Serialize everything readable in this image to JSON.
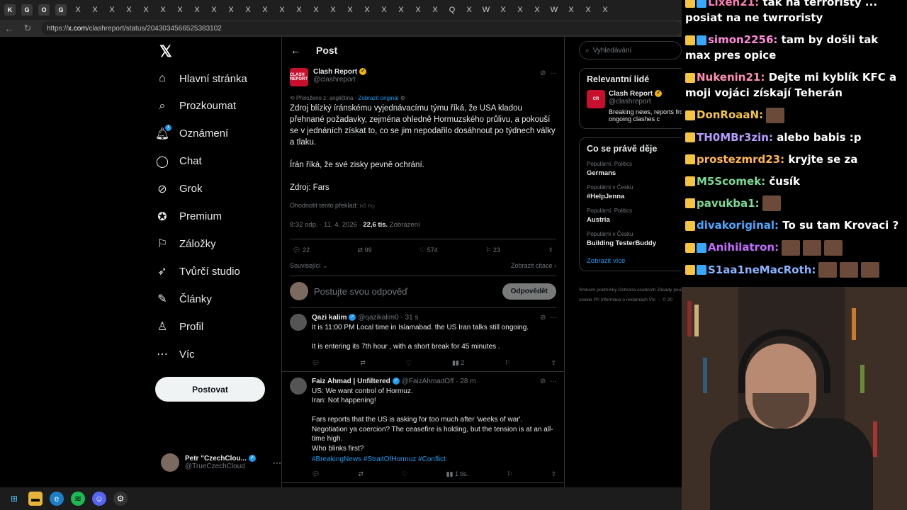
{
  "browser": {
    "url_prefix": "https://",
    "url_host": "x.com",
    "url_path": "/clashreport/status/2043034566525383102",
    "tabs": [
      "K",
      "G",
      "O",
      "G",
      "X",
      "X",
      "X",
      "X",
      "X",
      "X",
      "X",
      "X",
      "X",
      "X",
      "X",
      "X",
      "X",
      "X",
      "X",
      "X",
      "X",
      "X",
      "X",
      "X",
      "X",
      "X",
      "Q",
      "X",
      "W",
      "X",
      "X",
      "X",
      "W",
      "X",
      "X",
      "X"
    ]
  },
  "nav": {
    "items": [
      {
        "label": "Hlavní stránka",
        "icon": "home-icon"
      },
      {
        "label": "Prozkoumat",
        "icon": "search-icon"
      },
      {
        "label": "Oznámení",
        "icon": "bell-icon"
      },
      {
        "label": "Chat",
        "icon": "chat-icon"
      },
      {
        "label": "Grok",
        "icon": "grok-icon"
      },
      {
        "label": "Premium",
        "icon": "premium-icon"
      },
      {
        "label": "Záložky",
        "icon": "bookmark-icon"
      },
      {
        "label": "Tvůrčí studio",
        "icon": "rocket-icon"
      },
      {
        "label": "Články",
        "icon": "article-icon"
      },
      {
        "label": "Profil",
        "icon": "profile-icon"
      },
      {
        "label": "Víc",
        "icon": "more-icon"
      }
    ],
    "notification_badge": "1",
    "post_button": "Postovat",
    "account_name": "Petr \"CzechClou...",
    "account_handle": "@TrueCzechCloud"
  },
  "header": {
    "title": "Post"
  },
  "post": {
    "author": "Clash Report",
    "handle": "@clashreport",
    "avatar_text": "CLASH REPORT",
    "translated_from": "Přeloženo z: angličtina",
    "show_original": "Zobrazit originál",
    "text": "Zdroj blízký íránskému vyjednávacímu týmu říká, že USA kladou přehnané požadavky, zejména ohledně Hormuzského průlivu, a pokouší se v jednáních získat to, co se jim nepodařilo dosáhnout po týdnech války a tlaku.\n\nÍrán říká, že své zisky pevně ochrání.\n\nZdroj: Fars",
    "rate_translation": "Ohodnotit tento překlad:",
    "time": "8:32 odp. · 11. 4. 2026 · ",
    "views": "22,6 tis.",
    "views_label": " Zobrazení",
    "replies": "22",
    "reposts": "99",
    "likes": "574",
    "bookmarks": "23",
    "related": "Související",
    "show_quotes": "Zobrazit citace",
    "reply_placeholder": "Postujte svou odpověď",
    "reply_button": "Odpovědět"
  },
  "replies": [
    {
      "name": "Qazi kalim",
      "handle": "@qazikalim0 · 31 s",
      "text": "It is 11:00 PM Local time in Islamabad. the US Iran talks still ongoing.\n\nIt is entering its 7th hour , with a short break for 45 minutes .",
      "tags": "",
      "views": "2"
    },
    {
      "name": "Faiz Ahmad | Unfiltered",
      "handle": "@FaizAhmadOff · 28 m",
      "text": "US: We want control of Hormuz.\nIran: Not happening!\n\nFars reports that the US is asking for too much after 'weeks of war'.\nNegotiation ya coercion? The ceasefire is holding, but the tension is at an all-time high.\nWho blinks first?",
      "tags": "#BreakingNews #StraitOfHormuz #Conflict",
      "views": "1 tis."
    }
  ],
  "right": {
    "search_placeholder": "Vyhledávání",
    "relevant_title": "Relevantní lidé",
    "relevant_name": "Clash Report",
    "relevant_handle": "@clashreport",
    "relevant_bio": "Breaking news, reports from ongoing clashes c",
    "trending_title": "Co se právě děje",
    "trends": [
      {
        "context": "Populární: Politics",
        "topic": "Germans"
      },
      {
        "context": "Populární v Česku",
        "topic": "#HelpJenna"
      },
      {
        "context": "Populární: Politics",
        "topic": "Austria"
      },
      {
        "context": "Populární v Česku",
        "topic": "Building TesterBuddy"
      }
    ],
    "show_more": "Zobrazit více",
    "footer": "Smluvní podmínky   Ochrana osobních   Zásady používání souborů cookie   Pří   Informace o reklamách   Víc ···   © 20"
  },
  "chat": [
    {
      "user": "Lixen21:",
      "color": "#ff7eb6",
      "text": " tak na terroristy ... posiat na ne twrroristy"
    },
    {
      "user": "simon2256:",
      "color": "#ff8ad8",
      "text": " tam by došli tak max pres opice"
    },
    {
      "user": "Nukenin21:",
      "color": "#ff8fb0",
      "text": " Dejte mi kyblík KFC a moji vojáci získají Teherán"
    },
    {
      "user": "DonRoaaN:",
      "color": "#f5c542",
      "text": ""
    },
    {
      "user": "TH0MBr3zin:",
      "color": "#b99cff",
      "text": " alebo babis :p"
    },
    {
      "user": "prostezmrd23:",
      "color": "#ffb84d",
      "text": " kryjte se za"
    },
    {
      "user": "M5Scomek:",
      "color": "#7cd992",
      "text": " čusík"
    },
    {
      "user": "pavukba1:",
      "color": "#7cd992",
      "text": ""
    },
    {
      "user": "divakoriginal:",
      "color": "#4aa8ff",
      "text": " To su tam Krovaci ?"
    },
    {
      "user": "Anihilatron:",
      "color": "#c56cff",
      "text": ""
    },
    {
      "user": "S1aa1neMacRoth:",
      "color": "#8ab4ff",
      "text": ""
    }
  ],
  "taskbar": [
    "windows-icon",
    "folder-icon",
    "edge-icon",
    "spotify-icon",
    "discord-icon",
    "steam-icon"
  ],
  "colors": {
    "accent": "#1d9bf0",
    "background": "#000000",
    "text": "#e7e9ea",
    "muted": "#71767b"
  }
}
